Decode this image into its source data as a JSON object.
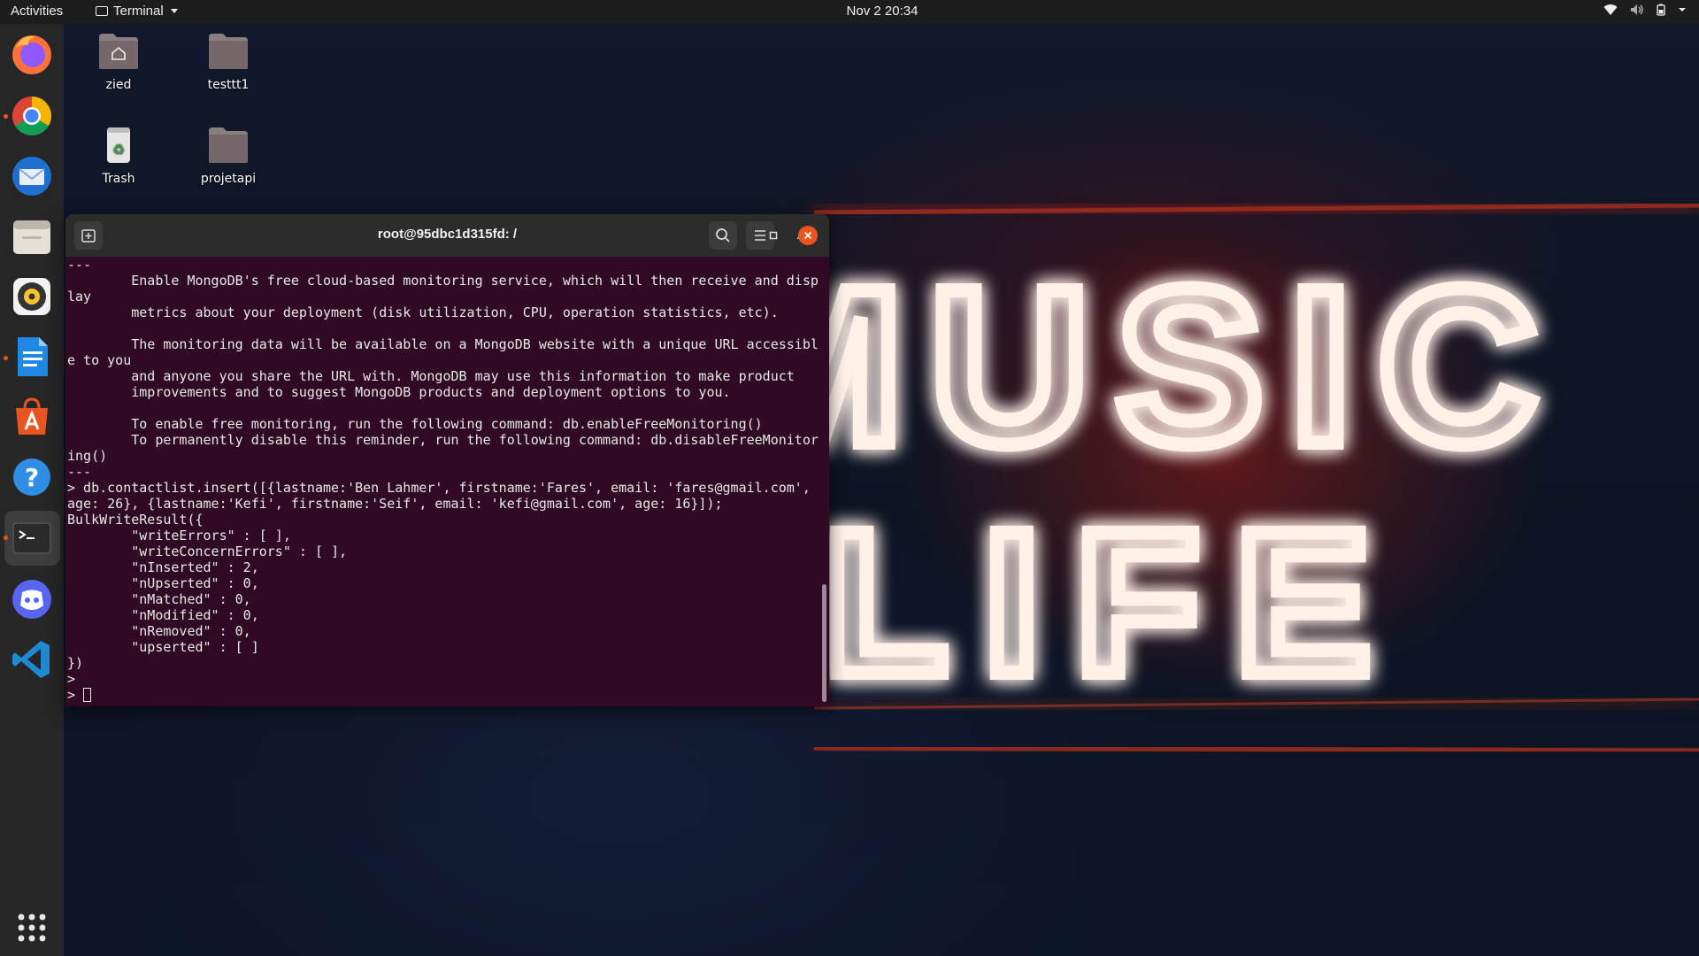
{
  "topbar": {
    "activities": "Activities",
    "app_name": "Terminal",
    "clock": "Nov 2  20:34",
    "tray_icons": [
      "wifi-icon",
      "volume-icon",
      "battery-icon",
      "chevron-down-icon"
    ]
  },
  "dock": {
    "items": [
      {
        "name": "Firefox",
        "icon": "firefox-icon"
      },
      {
        "name": "Google Chrome",
        "icon": "chrome-icon"
      },
      {
        "name": "Thunderbird",
        "icon": "thunderbird-icon"
      },
      {
        "name": "Files",
        "icon": "files-icon"
      },
      {
        "name": "Rhythmbox",
        "icon": "rhythmbox-icon"
      },
      {
        "name": "LibreOffice Writer",
        "icon": "writer-icon"
      },
      {
        "name": "Ubuntu Software",
        "icon": "software-icon"
      },
      {
        "name": "Help",
        "icon": "help-icon"
      },
      {
        "name": "Terminal",
        "icon": "terminal-icon"
      },
      {
        "name": "Discord",
        "icon": "discord-icon"
      },
      {
        "name": "Visual Studio Code",
        "icon": "vscode-icon"
      },
      {
        "name": "Show Applications",
        "icon": "grid-icon"
      }
    ]
  },
  "desktop": {
    "icons": [
      {
        "label": "zied",
        "icon": "home-folder-icon"
      },
      {
        "label": "testtt1",
        "icon": "folder-icon"
      },
      {
        "label": "Trash",
        "icon": "trash-icon"
      },
      {
        "label": "projetapi",
        "icon": "folder-icon"
      }
    ]
  },
  "terminal": {
    "title": "root@95dbc1d315fd: /",
    "output": "---\n        Enable MongoDB's free cloud-based monitoring service, which will then receive and disp\nlay\n        metrics about your deployment (disk utilization, CPU, operation statistics, etc).\n\n        The monitoring data will be available on a MongoDB website with a unique URL accessibl\ne to you\n        and anyone you share the URL with. MongoDB may use this information to make product\n        improvements and to suggest MongoDB products and deployment options to you.\n\n        To enable free monitoring, run the following command: db.enableFreeMonitoring()\n        To permanently disable this reminder, run the following command: db.disableFreeMonitor\ning()\n---\n> db.contactlist.insert([{lastname:'Ben Lahmer', firstname:'Fares', email: 'fares@gmail.com',\nage: 26}, {lastname:'Kefi', firstname:'Seif', email: 'kefi@gmail.com', age: 16}]);\nBulkWriteResult({\n        \"writeErrors\" : [ ],\n        \"writeConcernErrors\" : [ ],\n        \"nInserted\" : 2,\n        \"nUpserted\" : 0,\n        \"nMatched\" : 0,\n        \"nModified\" : 0,\n        \"nRemoved\" : 0,\n        \"upserted\" : [ ]\n})\n>",
    "prompt": "> "
  },
  "wallpaper": {
    "text_top": "MUSIC",
    "text_bottom": "LIFE"
  },
  "colors": {
    "terminal_bg": "#300a24",
    "close_button": "#e95420",
    "neon": "#ffd0c0"
  }
}
